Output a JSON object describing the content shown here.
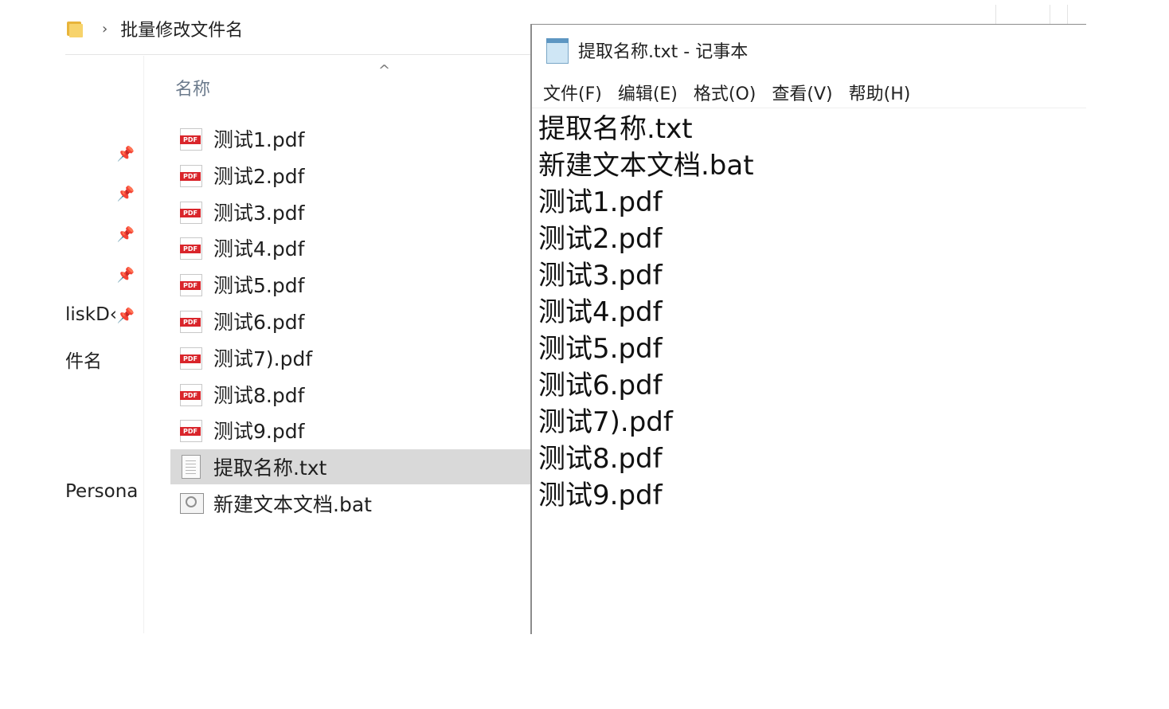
{
  "explorer": {
    "breadcrumb": {
      "separator": "›",
      "folder": "批量修改文件名"
    },
    "nav_labels": [
      "liskD‹",
      "件名",
      "Persona"
    ],
    "column_header": "名称",
    "sort_indicator": "^",
    "files": [
      {
        "name": "测试1.pdf",
        "icon": "pdf-icon"
      },
      {
        "name": "测试2.pdf",
        "icon": "pdf-icon"
      },
      {
        "name": "测试3.pdf",
        "icon": "pdf-icon"
      },
      {
        "name": "测试4.pdf",
        "icon": "pdf-icon"
      },
      {
        "name": "测试5.pdf",
        "icon": "pdf-icon"
      },
      {
        "name": "测试6.pdf",
        "icon": "pdf-icon"
      },
      {
        "name": "测试7).pdf",
        "icon": "pdf-icon"
      },
      {
        "name": "测试8.pdf",
        "icon": "pdf-icon"
      },
      {
        "name": "测试9.pdf",
        "icon": "pdf-icon"
      },
      {
        "name": "提取名称.txt",
        "icon": "txt-file-icon",
        "selected": true
      },
      {
        "name": "新建文本文档.bat",
        "icon": "bat-file-icon"
      }
    ],
    "pdf_badge": "PDF"
  },
  "notepad": {
    "title": "提取名称.txt - 记事本",
    "menu": [
      "文件(F)",
      "编辑(E)",
      "格式(O)",
      "查看(V)",
      "帮助(H)"
    ],
    "content": [
      "提取名称.txt",
      "新建文本文档.bat",
      "测试1.pdf",
      "测试2.pdf",
      "测试3.pdf",
      "测试4.pdf",
      "测试5.pdf",
      "测试6.pdf",
      "测试7).pdf",
      "测试8.pdf",
      "测试9.pdf"
    ]
  },
  "colors": {
    "selection": "#d9d9d9",
    "pdf_red": "#d9252b",
    "folder_yellow": "#f7d36b"
  }
}
